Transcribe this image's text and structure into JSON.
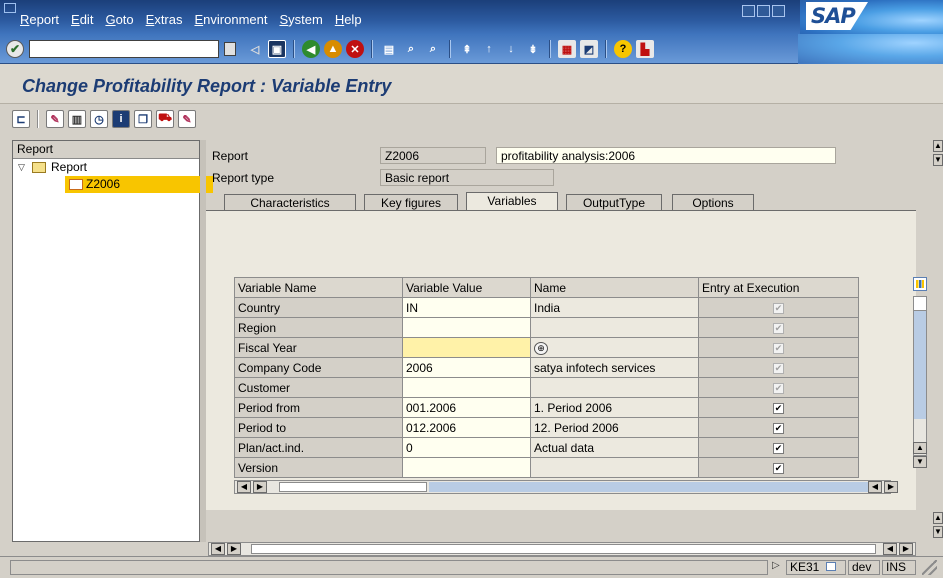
{
  "menu": [
    "Report",
    "Edit",
    "Goto",
    "Extras",
    "Environment",
    "System",
    "Help"
  ],
  "logo_text": "SAP",
  "title": "Change Profitability Report : Variable Entry",
  "tree": {
    "header": "Report",
    "root": "Report",
    "child": "Z2006"
  },
  "header": {
    "report_label": "Report",
    "report_value": "Z2006",
    "report_desc": "profitability analysis:2006",
    "type_label": "Report type",
    "type_value": "Basic report"
  },
  "tabs": [
    "Characteristics",
    "Key figures",
    "Variables",
    "OutputType",
    "Options"
  ],
  "active_tab": "Variables",
  "table": {
    "columns": [
      "Variable Name",
      "Variable Value",
      "Name",
      "Entry at Execution"
    ],
    "rows": [
      {
        "name": "Country",
        "value": "IN",
        "desc": "India",
        "entry": "disabled-checked"
      },
      {
        "name": "Region",
        "value": "",
        "desc": "",
        "entry": "disabled-checked"
      },
      {
        "name": "Fiscal Year",
        "value": "",
        "desc": "",
        "entry": "disabled-checked"
      },
      {
        "name": "Company Code",
        "value": "2006",
        "desc": "satya infotech  services",
        "entry": "disabled-checked"
      },
      {
        "name": "Customer",
        "value": "",
        "desc": "",
        "entry": "disabled-checked"
      },
      {
        "name": "Period from",
        "value": "001.2006",
        "desc": "1. Period 2006",
        "entry": "checked"
      },
      {
        "name": "Period to",
        "value": "012.2006",
        "desc": "12. Period 2006",
        "entry": "checked"
      },
      {
        "name": "Plan/act.ind.",
        "value": "0",
        "desc": "Actual data",
        "entry": "checked"
      },
      {
        "name": "Version",
        "value": "",
        "desc": "",
        "entry": "checked"
      }
    ]
  },
  "status": {
    "transaction": "KE31",
    "system": "dev",
    "mode": "INS"
  },
  "colors": {
    "menubar": "#2c5aa0",
    "title": "#1c3c74",
    "selection": "#f8c500",
    "required_field": "#fff2a8"
  }
}
